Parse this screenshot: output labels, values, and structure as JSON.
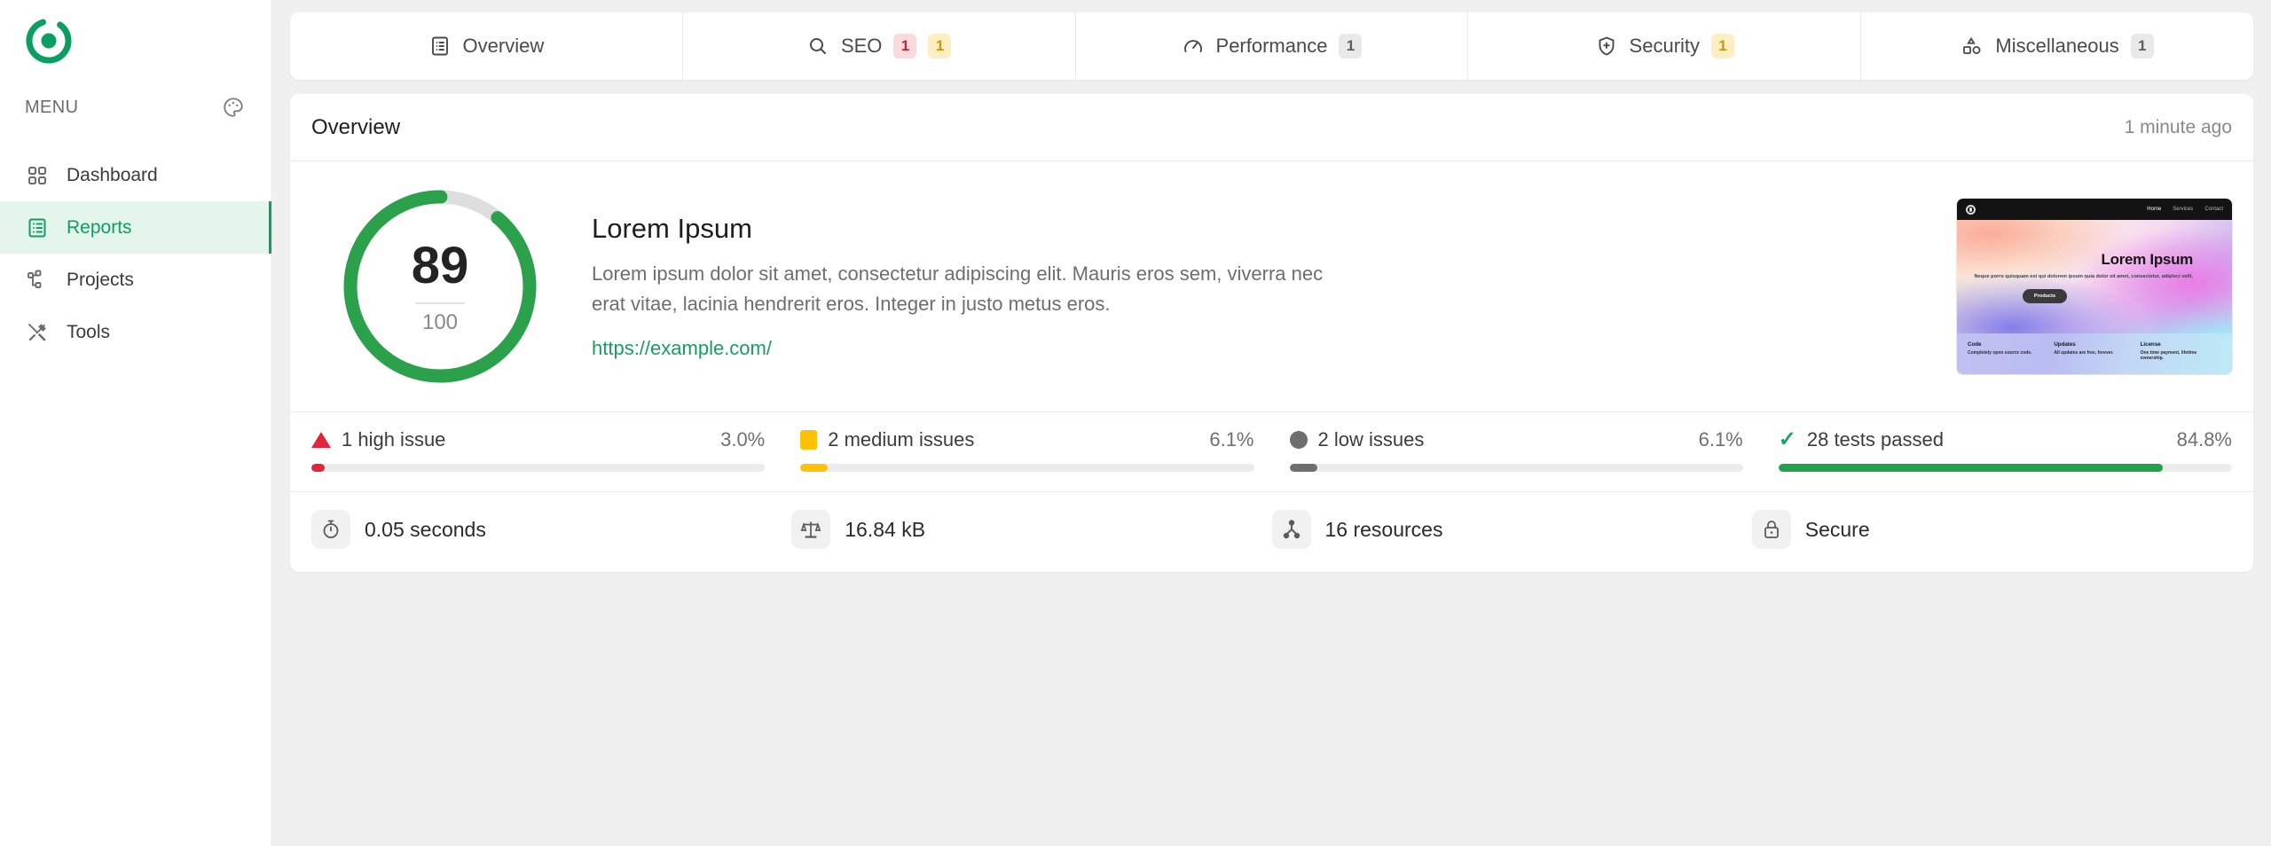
{
  "sidebar": {
    "logo_name": "app-logo",
    "menu_label": "MENU",
    "theme_icon": "palette-icon",
    "items": [
      {
        "label": "Dashboard",
        "icon": "grid-icon",
        "active": false
      },
      {
        "label": "Reports",
        "icon": "report-list-icon",
        "active": true
      },
      {
        "label": "Projects",
        "icon": "sitemap-icon",
        "active": false
      },
      {
        "label": "Tools",
        "icon": "tools-icon",
        "active": false
      }
    ]
  },
  "tabs": [
    {
      "label": "Overview",
      "icon": "list-document-icon",
      "badges": []
    },
    {
      "label": "SEO",
      "icon": "search-icon",
      "badges": [
        {
          "value": "1",
          "tone": "red"
        },
        {
          "value": "1",
          "tone": "yellow"
        }
      ]
    },
    {
      "label": "Performance",
      "icon": "gauge-icon",
      "badges": [
        {
          "value": "1",
          "tone": "gray"
        }
      ]
    },
    {
      "label": "Security",
      "icon": "shield-plus-icon",
      "badges": [
        {
          "value": "1",
          "tone": "yellow"
        }
      ]
    },
    {
      "label": "Miscellaneous",
      "icon": "shapes-icon",
      "badges": [
        {
          "value": "1",
          "tone": "gray"
        }
      ]
    }
  ],
  "card": {
    "title": "Overview",
    "timestamp": "1 minute ago"
  },
  "score": {
    "value": "89",
    "max": "100",
    "percent": 89,
    "color": "#2aa14a",
    "track_color": "#dedede"
  },
  "site": {
    "title": "Lorem Ipsum",
    "description": "Lorem ipsum dolor sit amet, consectetur adipiscing elit. Mauris eros sem, viverra nec erat vitae, lacinia hendrerit eros. Integer in justo metus eros.",
    "url": "https://example.com/",
    "link_color": "#13a05f"
  },
  "thumbnail": {
    "nav_links": [
      "Home",
      "Services",
      "Contact"
    ],
    "hero_title": "Lorem Ipsum",
    "hero_subtitle": "Neque porro quisquam est qui dolorem ipsum quia dolor sit amet, consectetur, adipisci velit.",
    "hero_button": "Products",
    "features": [
      {
        "title": "Code",
        "text": "Completely open source code."
      },
      {
        "title": "Updates",
        "text": "All updates are free, forever."
      },
      {
        "title": "License",
        "text": "One time payment, lifetime ownership."
      }
    ]
  },
  "issues": [
    {
      "label": "1 high issue",
      "percent": "3.0%",
      "fill": 3.0,
      "color": "#e0253c",
      "marker": "triangle-marker"
    },
    {
      "label": "2 medium issues",
      "percent": "6.1%",
      "fill": 6.1,
      "color": "#ffc107",
      "marker": "square-marker"
    },
    {
      "label": "2 low issues",
      "percent": "6.1%",
      "fill": 6.1,
      "color": "#6e6e6e",
      "marker": "circle-marker"
    },
    {
      "label": "28 tests passed",
      "percent": "84.8%",
      "fill": 84.8,
      "color": "#21a14a",
      "marker": "check-marker"
    }
  ],
  "stats": [
    {
      "value": "0.05 seconds",
      "icon": "stopwatch-icon"
    },
    {
      "value": "16.84 kB",
      "icon": "scales-icon"
    },
    {
      "value": "16 resources",
      "icon": "resources-icon"
    },
    {
      "value": "Secure",
      "icon": "lock-icon"
    }
  ]
}
